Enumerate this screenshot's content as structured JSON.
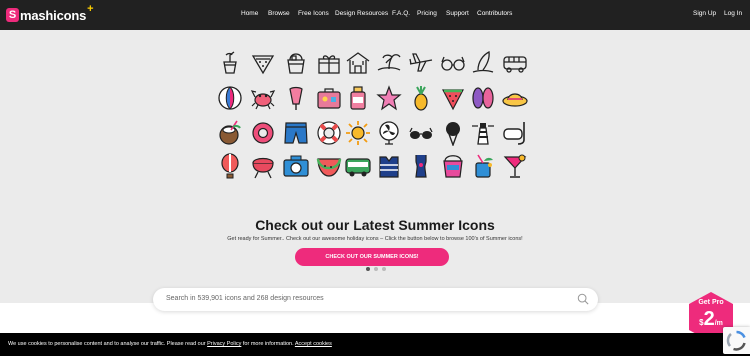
{
  "brand": {
    "badge": "S",
    "name": "mashicons",
    "plus": "+"
  },
  "nav": {
    "items": [
      "Home",
      "Browse",
      "Free Icons",
      "Design Resources",
      "F.A.Q.",
      "Pricing",
      "Support",
      "Contributors"
    ],
    "signup": "Sign Up",
    "login": "Log In"
  },
  "hero": {
    "title": "Check out our Latest Summer Icons",
    "subtitle": "Get ready for Summer.. Check out our awesome holiday icons – Click the button below to browse 100's of Summer icons!",
    "cta": "CHECK OUT OUR SUMMER ICONS!",
    "slides": 3,
    "active_slide": 0
  },
  "icons": {
    "row1": [
      "cocktail-icon",
      "watermelon-slice-icon",
      "ice-bucket-icon",
      "gift-icon",
      "beach-house-icon",
      "palm-island-icon",
      "airplane-icon",
      "sunglasses-icon",
      "surfboard-icon",
      "van-icon"
    ],
    "row2": [
      "beach-ball-icon",
      "crab-icon",
      "ice-cream-icon",
      "suitcase-icon",
      "sunscreen-icon",
      "starfish-icon",
      "pineapple-icon",
      "watermelon-icon",
      "flip-flops-icon",
      "sun-hat-icon"
    ],
    "row3": [
      "coconut-drink-icon",
      "swim-ring-icon",
      "swim-shorts-icon",
      "lifebuoy-icon",
      "sun-icon",
      "fan-icon",
      "sunglasses-icon",
      "ice-cream-cone-icon",
      "lighthouse-icon",
      "snorkel-mask-icon"
    ],
    "row4": [
      "hot-air-balloon-icon",
      "barbecue-grill-icon",
      "camera-icon",
      "watermelon-slice-icon",
      "camper-van-icon",
      "life-vest-icon",
      "swimsuit-icon",
      "sand-bucket-icon",
      "island-drink-icon",
      "cocktail-glass-icon"
    ]
  },
  "search": {
    "placeholder": "Search in  539,901  icons and 268 design resources"
  },
  "pro": {
    "label": "Get Pro",
    "currency": "$",
    "price": "2",
    "unit": "/m"
  },
  "cookie": {
    "text_before": "We use cookies to personalise content and to analyse our traffic. Please read our ",
    "policy_link": "Privacy Policy",
    "text_after": " for more information. ",
    "accept_link": "Accept cookies"
  },
  "colors": {
    "brand": "#ee2b7c",
    "nav_bg": "#212121",
    "accent_yellow": "#ffd000"
  }
}
